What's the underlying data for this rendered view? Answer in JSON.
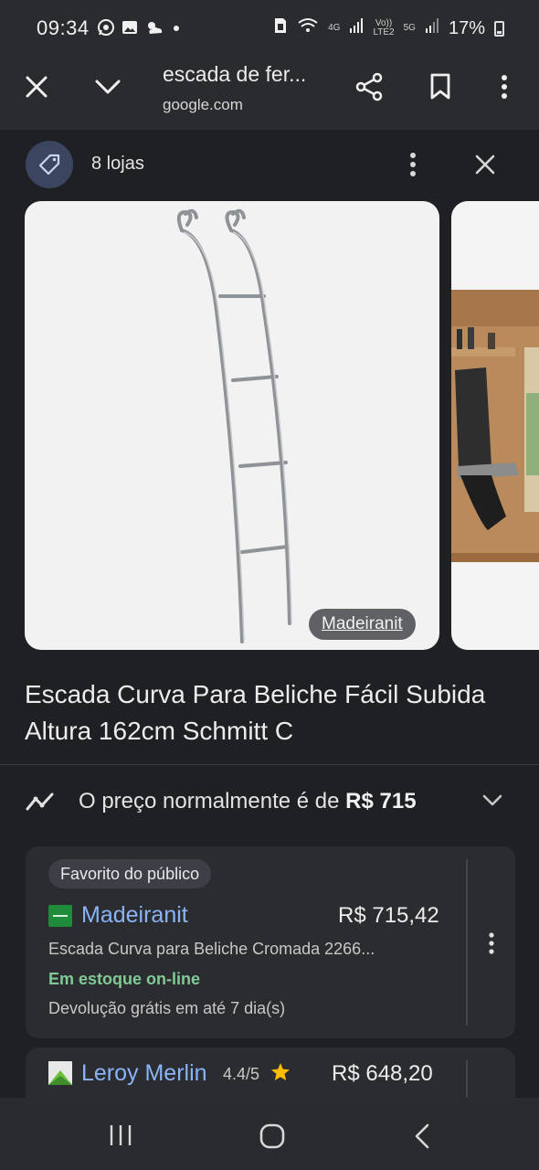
{
  "status_bar": {
    "time": "09:34",
    "network_4g": "4G",
    "volte": "Vo))\nLTE2",
    "network_5g": "5G",
    "battery": "17%"
  },
  "toolbar": {
    "title": "escada de fer...",
    "url": "google.com"
  },
  "sheet": {
    "stores_count": "8 lojas"
  },
  "gallery": {
    "merchant_chip": "Madeiranit"
  },
  "product": {
    "title": "Escada Curva Para Beliche Fácil Subida Altura 162cm Schmitt C"
  },
  "price_insight": {
    "prefix": "O preço normalmente é de",
    "value": "R$ 715"
  },
  "offers": [
    {
      "badge": "Favorito do público",
      "store": "Madeiranit",
      "price": "R$ 715,42",
      "description": "Escada Curva para Beliche Cromada 2266...",
      "stock": "Em estoque on-line",
      "returns": "Devolução grátis em até 7 dia(s)"
    },
    {
      "store": "Leroy Merlin",
      "rating": "4.4/5",
      "price": "R$ 648,20"
    }
  ],
  "colors": {
    "link": "#8ab4f8",
    "in_stock": "#81c995",
    "background": "#1f2023"
  }
}
